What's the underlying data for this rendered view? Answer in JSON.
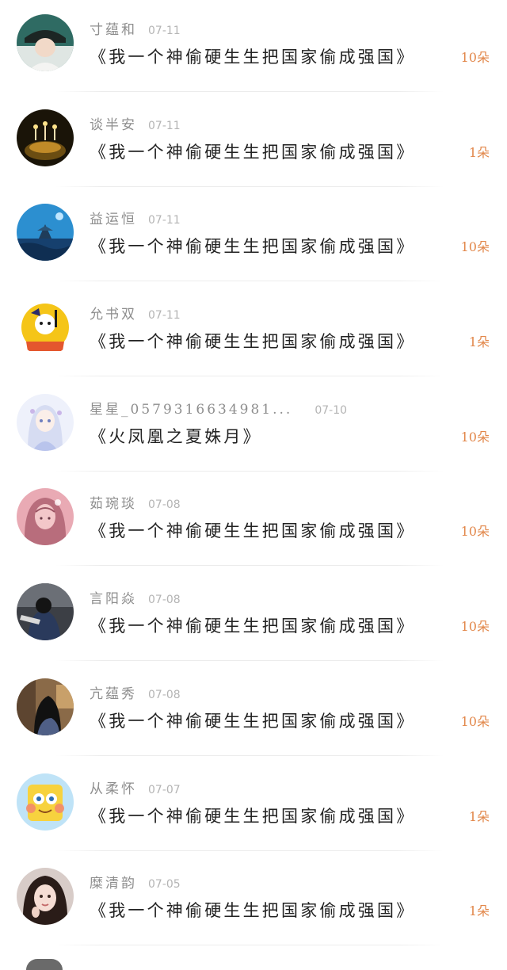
{
  "comments": [
    {
      "username": "寸蕴和",
      "date": "07-11",
      "title": "《我一个神偷硬生生把国家偷成强国》",
      "flowers": "10朵",
      "avatar": "avatar-girl-hat"
    },
    {
      "username": "谈半安",
      "date": "07-11",
      "title": "《我一个神偷硬生生把国家偷成强国》",
      "flowers": "1朵",
      "avatar": "avatar-candles"
    },
    {
      "username": "益运恒",
      "date": "07-11",
      "title": "《我一个神偷硬生生把国家偷成强国》",
      "flowers": "10朵",
      "avatar": "avatar-blue-pagoda"
    },
    {
      "username": "允书双",
      "date": "07-11",
      "title": "《我一个神偷硬生生把国家偷成强国》",
      "flowers": "1朵",
      "avatar": "avatar-cartoon-yellow"
    },
    {
      "username": "星星_0579316634981...",
      "date": "07-10",
      "title": "《火凤凰之夏姝月》",
      "flowers": "10朵",
      "avatar": "avatar-anime-girl"
    },
    {
      "username": "茹琬琰",
      "date": "07-08",
      "title": "《我一个神偷硬生生把国家偷成强国》",
      "flowers": "10朵",
      "avatar": "avatar-pink-girl"
    },
    {
      "username": "言阳焱",
      "date": "07-08",
      "title": "《我一个神偷硬生生把国家偷成强国》",
      "flowers": "10朵",
      "avatar": "avatar-dark-figure"
    },
    {
      "username": "亢蕴秀",
      "date": "07-08",
      "title": "《我一个神偷硬生生把国家偷成强国》",
      "flowers": "10朵",
      "avatar": "avatar-girl-back"
    },
    {
      "username": "从柔怀",
      "date": "07-07",
      "title": "《我一个神偷硬生生把国家偷成强国》",
      "flowers": "1朵",
      "avatar": "avatar-sponge"
    },
    {
      "username": "糜清韵",
      "date": "07-05",
      "title": "《我一个神偷硬生生把国家偷成强国》",
      "flowers": "1朵",
      "avatar": "avatar-girl-selfie"
    }
  ],
  "colors": {
    "username": "#8e8e8e",
    "date": "#b4b4b4",
    "title": "#222222",
    "flowers": "#e2874a",
    "divider": "#ececec"
  }
}
